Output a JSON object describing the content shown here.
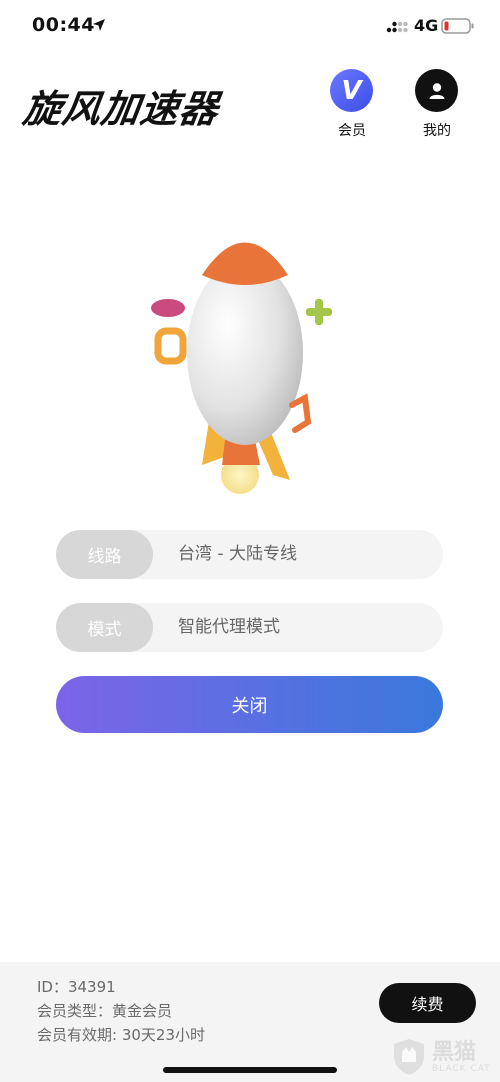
{
  "status_bar": {
    "time": "00:44",
    "network": "4G",
    "icons": [
      "location-arrow-icon",
      "signal-icon",
      "battery-icon"
    ]
  },
  "header": {
    "title": "旋风加速器",
    "vip_label": "会员",
    "vip_icon_letter": "V",
    "mine_label": "我的"
  },
  "connection": {
    "route_label": "线路",
    "route_value": "台湾 - 大陆专线",
    "mode_label": "模式",
    "mode_value": "智能代理模式",
    "action_label": "关闭"
  },
  "account": {
    "id_line": "ID：34391",
    "type_line": "会员类型：黄金会员",
    "expiry_line": "会员有效期: 30天23小时",
    "renew_label": "续费"
  },
  "watermark": {
    "text": "黑猫",
    "sub": "BLACK CAT"
  },
  "colors": {
    "accent_gradient_start": "#7d64e8",
    "accent_gradient_end": "#3a78dc",
    "vip_blue": "#4a57f0",
    "pill_bg": "#f4f4f4",
    "pill_label_bg": "#d7d7d7",
    "bottom_bg": "#f4f4f4",
    "rocket_orange": "#e8743a"
  }
}
